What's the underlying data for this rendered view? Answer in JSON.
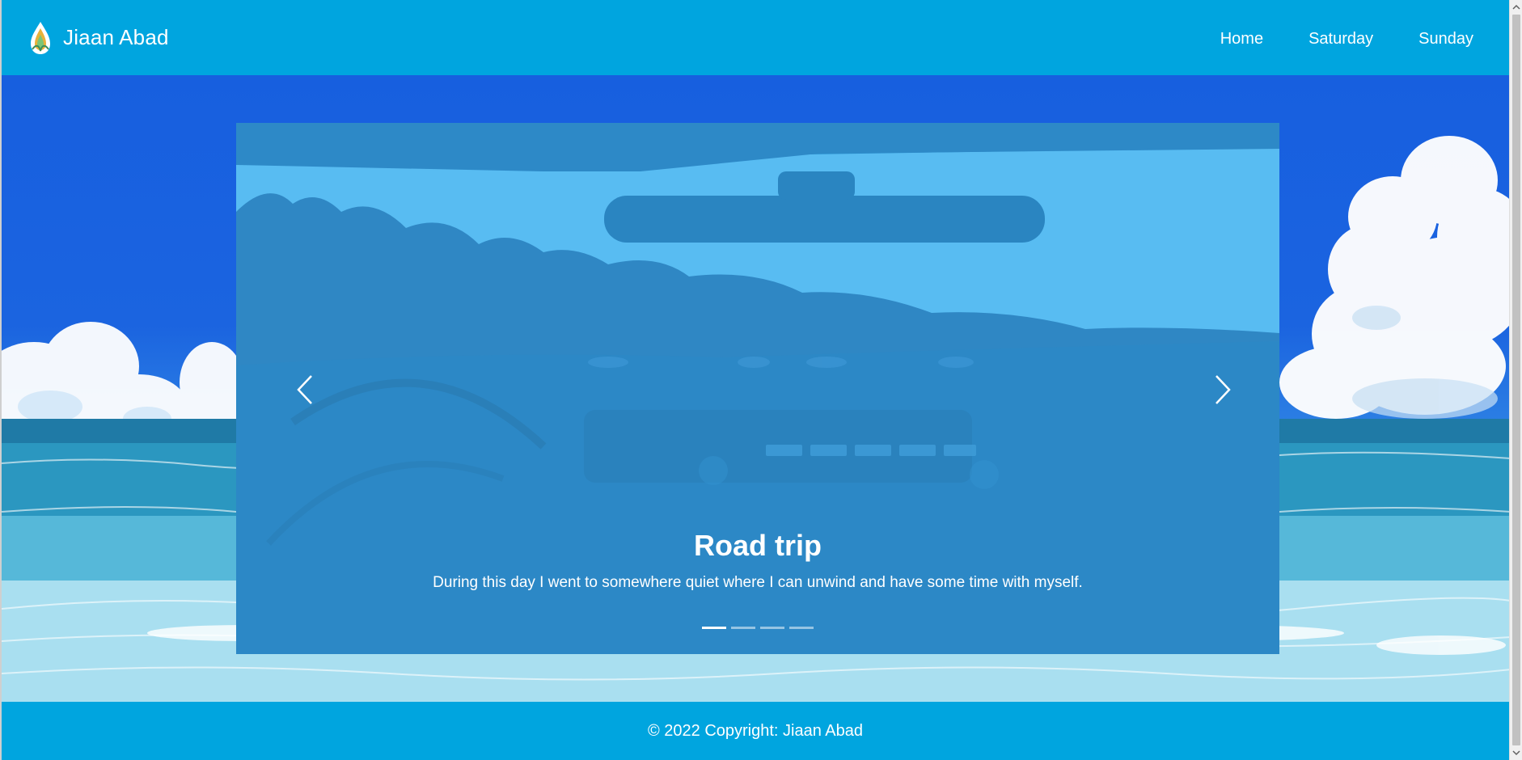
{
  "navbar": {
    "brand_name": "Jiaan Abad",
    "brand_logo_icon": "flame-drop-logo-icon",
    "links": [
      {
        "label": "Home"
      },
      {
        "label": "Saturday"
      },
      {
        "label": "Sunday"
      }
    ]
  },
  "carousel": {
    "active_slide": 1,
    "slide_count": 4,
    "slide": {
      "title": "Road trip",
      "text": "During this day I went to somewhere quiet where I can unwind and have some time with myself."
    },
    "prev_icon": "chevron-left-icon",
    "next_icon": "chevron-right-icon"
  },
  "footer": {
    "copyright": "© 2022 Copyright: Jiaan Abad"
  },
  "colors": {
    "navbar_bg": "#00a5df",
    "footer_bg": "#00a5df",
    "sky": "#175fdf",
    "carousel_tint": "#2a90cf",
    "text": "#ffffff"
  }
}
